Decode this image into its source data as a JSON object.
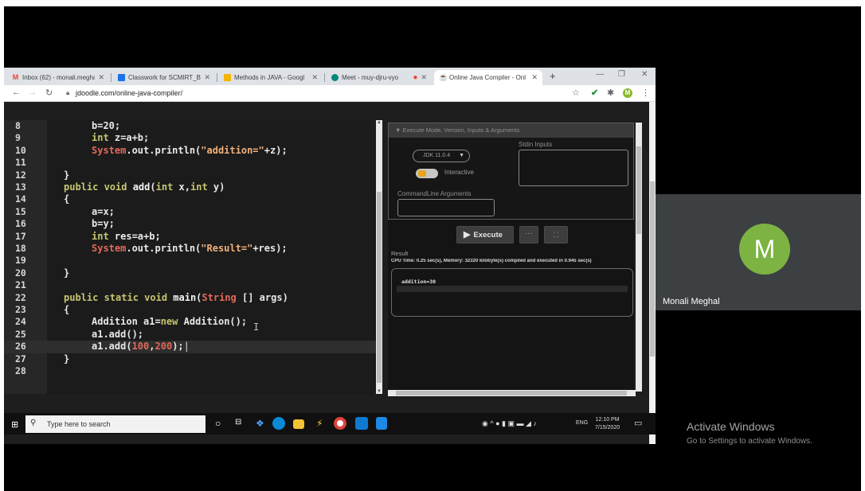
{
  "browser": {
    "tabs": [
      {
        "label": "Inbox (62) - monali.meghal",
        "icon_color": "#ea4335",
        "icon_glyph": "M"
      },
      {
        "label": "Classwork for SCMIRT_BBA",
        "icon_color": "#1a73e8",
        "icon_glyph": "▣"
      },
      {
        "label": "Methods in JAVA - Googl",
        "icon_color": "#f4b400",
        "icon_glyph": "▭"
      },
      {
        "label": "Meet - muy-djru-vyo",
        "icon_color": "#00897b",
        "icon_glyph": "◉"
      },
      {
        "label": "Online Java Compiler - Onl",
        "icon_color": "#e65100",
        "icon_glyph": "☕"
      }
    ],
    "url": "jdoodle.com/online-java-compiler/"
  },
  "editor": {
    "lines": [
      {
        "n": "8"
      },
      {
        "n": "9"
      },
      {
        "n": "10"
      },
      {
        "n": "11"
      },
      {
        "n": "12"
      },
      {
        "n": "13"
      },
      {
        "n": "14"
      },
      {
        "n": "15"
      },
      {
        "n": "16"
      },
      {
        "n": "17"
      },
      {
        "n": "18"
      },
      {
        "n": "19"
      },
      {
        "n": "20"
      },
      {
        "n": "21"
      },
      {
        "n": "22"
      },
      {
        "n": "23"
      },
      {
        "n": "24"
      },
      {
        "n": "25"
      },
      {
        "n": "26"
      },
      {
        "n": "27"
      },
      {
        "n": "28"
      }
    ],
    "code": {
      "l8": "b=20;",
      "l9_kw": "int",
      "l9": " z=a+b;",
      "l10_sys": "System",
      "l10_a": ".out.println(",
      "l10_str": "\"addition=\"",
      "l10_b": "+z);",
      "l12": "}",
      "l13_kw": "public void",
      "l13_fn": " add",
      "l13_a": "(",
      "l13_kw2": "int",
      "l13_b": " x,",
      "l13_kw3": "int",
      "l13_c": " y)",
      "l14": "{",
      "l15": "a=x;",
      "l16": "b=y;",
      "l17_kw": "int",
      "l17": " res=a+b;",
      "l18_sys": "System",
      "l18_a": ".out.println(",
      "l18_str": "\"Result=\"",
      "l18_b": "+res);",
      "l20": "}",
      "l22_kw": "public static void",
      "l22_fn": " main",
      "l22_a": "(",
      "l22_str": "String",
      "l22_b": " [] args)",
      "l23": "{",
      "l24_a": "Addition a1=",
      "l24_kw": "new",
      "l24_b": " Addition();",
      "l25": "a1.add();",
      "l26_a": "a1.add(",
      "l26_n1": "100",
      "l26_c": ",",
      "l26_n2": "200",
      "l26_b": ");",
      "l27": "}"
    }
  },
  "panel": {
    "header": "Execute Mode, Version, Inputs & Arguments",
    "jdk": "JDK 11.0.4",
    "interactive": "Interactive",
    "stdin_label": "Stdin Inputs",
    "cmd_label": "CommandLine Arguments",
    "execute": "Execute",
    "more": "···",
    "result_label": "Result",
    "cpu_line": "CPU Time: 0.25 sec(s), Memory: 32320 kilobyte(s) compiled and executed in 0.945 sec(s)",
    "output": "addition=30"
  },
  "taskbar": {
    "search_placeholder": "Type here to search",
    "lang": "ENG",
    "time": "12:10 PM",
    "date": "7/15/2020"
  },
  "meet": {
    "initial": "M",
    "participant": "Monali Meghal",
    "avatar_color": "#7cb342"
  },
  "watermark": {
    "title": "Activate Windows",
    "subtitle": "Go to Settings to activate Windows."
  }
}
